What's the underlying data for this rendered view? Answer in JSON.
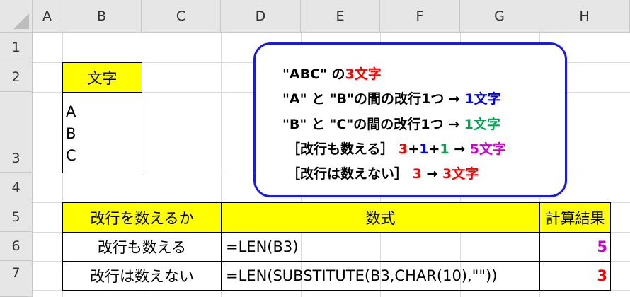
{
  "sheet": {
    "columns": [
      "A",
      "B",
      "C",
      "D",
      "E",
      "F",
      "G",
      "H"
    ],
    "rows": [
      "1",
      "2",
      "3",
      "4",
      "5",
      "6",
      "7"
    ]
  },
  "cells": {
    "b2": "文字",
    "b3_lines": [
      "A",
      "B",
      "C"
    ],
    "table_headers": [
      "改行を数えるか",
      "数式",
      "計算結果"
    ],
    "table_rows": [
      {
        "label": "改行も数える",
        "formula": "=LEN(B3)",
        "result": "5"
      },
      {
        "label": "改行は数えない",
        "formula": "=LEN(SUBSTITUTE(B3,CHAR(10),\"\"))",
        "result": "3"
      }
    ]
  },
  "note": {
    "line1": {
      "a": "\"ABC\" の",
      "b": "3文字"
    },
    "line2": {
      "a": "\"A\" と \"B\"の間の改行1つ → ",
      "b": "1文字"
    },
    "line3": {
      "a": "\"B\" と \"C\"の間の改行1つ → ",
      "b": "1文字"
    },
    "line4": {
      "a": "［改行も数える］ ",
      "n1": "3",
      "p1": "+",
      "n2": "1",
      "p2": "+",
      "n3": "1",
      "arrow": " → ",
      "b": "5文字"
    },
    "line5": {
      "a": "［改行は数えない］ ",
      "n1": "3",
      "arrow": " → ",
      "b": "3文字"
    }
  },
  "colors": {
    "highlight": "#ffff00",
    "note_border": "#1a1ae6",
    "red": "#ff0000",
    "blue": "#0000ee",
    "green": "#00a550",
    "purple": "#cc00cc"
  }
}
